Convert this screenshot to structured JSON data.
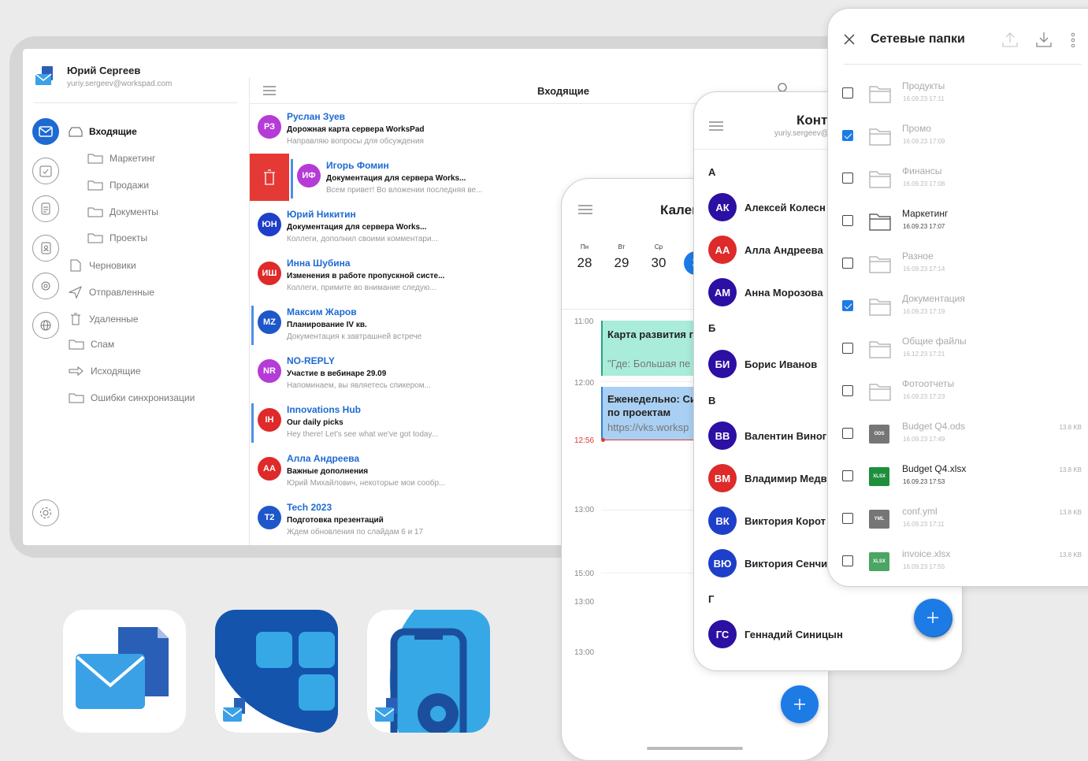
{
  "user": {
    "name": "Юрий Сергеев",
    "email": "yuriy.sergeev@workspad.com"
  },
  "folders": [
    {
      "label": "Входящие"
    },
    {
      "label": "Маркетинг"
    },
    {
      "label": "Продажи"
    },
    {
      "label": "Документы"
    },
    {
      "label": "Проекты"
    },
    {
      "label": "Черновики"
    },
    {
      "label": "Отправленные"
    },
    {
      "label": "Удаленные"
    },
    {
      "label": "Спам"
    },
    {
      "label": "Исходящие"
    },
    {
      "label": "Ошибки синхронизации"
    }
  ],
  "inbox": {
    "title": "Входящие"
  },
  "mails": [
    {
      "initials": "РЗ",
      "from": "Руслан Зуев",
      "subject": "Дорожная карта сервера WorksPad",
      "preview": "Направляю вопросы для обсуждения",
      "color": "#b53bd6"
    },
    {
      "initials": "ИФ",
      "from": "Игорь Фомин",
      "subject": "Документация для сервера Works...",
      "preview": "Всем привет! Во вложении последняя ве...",
      "color": "#b53bd6"
    },
    {
      "initials": "ЮН",
      "from": "Юрий Никитин",
      "subject": "Документация для сервера Works...",
      "preview": "Коллеги, дополнил своими комментари...",
      "color": "#1e3fc9"
    },
    {
      "initials": "ИШ",
      "from": "Инна Шубина",
      "subject": "Изменения в работе пропускной систе...",
      "preview": "Коллеги, примите во внимание следую...",
      "color": "#de2a2a"
    },
    {
      "initials": "MZ",
      "from": "Максим Жаров",
      "subject": "Планирование IV кв.",
      "preview": "Документация к завтрашней встрече",
      "color": "#1e57c9"
    },
    {
      "initials": "NR",
      "from": "NO-REPLY",
      "subject": "Участие в вебинаре 29.09",
      "preview": "Напоминаем, вы являетесь спикером...",
      "color": "#b53bd6"
    },
    {
      "initials": "IH",
      "from": "Innovations Hub",
      "subject": "Our daily picks",
      "preview": "Hey there! Let's see what we've got today...",
      "color": "#de2a2a"
    },
    {
      "initials": "АА",
      "from": "Алла Андреева",
      "subject": "Важные дополнения",
      "preview": "Юрий Михайлович, некоторые мои сообр...",
      "color": "#de2a2a"
    },
    {
      "initials": "T2",
      "from": "Tech 2023",
      "subject": "Подготовка презентаций",
      "preview": "Ждем обновления по слайдам 6 и 17",
      "color": "#1e57c9"
    }
  ],
  "calendar": {
    "title": "Кален",
    "days": [
      {
        "name": "Пн",
        "date": "28"
      },
      {
        "name": "Вт",
        "date": "29"
      },
      {
        "name": "Ср",
        "date": "30"
      },
      {
        "name": "Ч",
        "date": "3"
      }
    ],
    "times": [
      "11:00",
      "12:00",
      "12:56",
      "13:00",
      "15:00",
      "13:00",
      "13:00"
    ],
    "events": [
      {
        "title": "Карта развития г",
        "note": "\"Где: Большая пе"
      },
      {
        "title": "Еженедельно: Си",
        "title2": "по проектам",
        "note": "https://vks.worksp"
      }
    ]
  },
  "contacts": {
    "title": "Конт",
    "email": "yuriy.sergeev@",
    "letters": [
      "А",
      "Б",
      "В",
      "Г"
    ],
    "items": [
      {
        "initials": "АК",
        "name": "Алексей Колесн",
        "color": "#2c0fa3"
      },
      {
        "initials": "АА",
        "name": "Алла Андреева",
        "color": "#de2a2a"
      },
      {
        "initials": "АМ",
        "name": "Анна Морозова",
        "color": "#2c0fa3"
      },
      {
        "initials": "БИ",
        "name": "Борис Иванов",
        "color": "#2c0fa3"
      },
      {
        "initials": "ВВ",
        "name": "Валентин Виног",
        "color": "#2c0fa3"
      },
      {
        "initials": "ВМ",
        "name": "Владимир Медв",
        "color": "#de2a2a"
      },
      {
        "initials": "ВК",
        "name": "Виктория Корот",
        "color": "#1e3fc9"
      },
      {
        "initials": "ВЮ",
        "name": "Виктория Сенчи",
        "color": "#1e3fc9"
      },
      {
        "initials": "ГС",
        "name": "Геннадий Синицын",
        "color": "#2c0fa3"
      }
    ]
  },
  "netfolders": {
    "title": "Сетевые папки",
    "items": [
      {
        "name": "Продукты",
        "date": "16.09.23 17:11",
        "checked": false,
        "dim": true,
        "kind": "folder",
        "size": ""
      },
      {
        "name": "Промо",
        "date": "16.09.23 17:09",
        "checked": true,
        "dim": true,
        "kind": "folder",
        "size": ""
      },
      {
        "name": "Финансы",
        "date": "16.09.23 17:08",
        "checked": false,
        "dim": true,
        "kind": "folder",
        "size": ""
      },
      {
        "name": "Маркетинг",
        "date": "16.09.23 17:07",
        "checked": false,
        "dim": false,
        "kind": "folder",
        "size": ""
      },
      {
        "name": "Разное",
        "date": "16.09.23 17:14",
        "checked": false,
        "dim": true,
        "kind": "folder",
        "size": ""
      },
      {
        "name": "Документация",
        "date": "16.09.23 17:19",
        "checked": true,
        "dim": true,
        "kind": "folder",
        "size": ""
      },
      {
        "name": "Общие файлы",
        "date": "16.12.23 17:21",
        "checked": false,
        "dim": true,
        "kind": "folder",
        "size": ""
      },
      {
        "name": "Фотоотчеты",
        "date": "16.09.23 17:23",
        "checked": false,
        "dim": true,
        "kind": "folder",
        "size": ""
      },
      {
        "name": "Budget Q4.ods",
        "date": "16.09.23 17:49",
        "checked": false,
        "dim": true,
        "kind": "ODS",
        "size": "13.8 KB"
      },
      {
        "name": "Budget Q4.xlsx",
        "date": "16.09.23 17:53",
        "checked": false,
        "dim": false,
        "kind": "XLSX",
        "size": "13.8 KB"
      },
      {
        "name": "conf.yml",
        "date": "16.09.23 17:11",
        "checked": false,
        "dim": true,
        "kind": "YML",
        "size": "13.8 KB"
      },
      {
        "name": "invoice.xlsx",
        "date": "16.09.23 17:55",
        "checked": false,
        "dim": true,
        "kind": "XLSX",
        "size": "13.8 KB"
      }
    ]
  },
  "colors": {
    "accent": "#1d6ad3",
    "fab": "#1d7be6",
    "delete": "#e53935"
  }
}
